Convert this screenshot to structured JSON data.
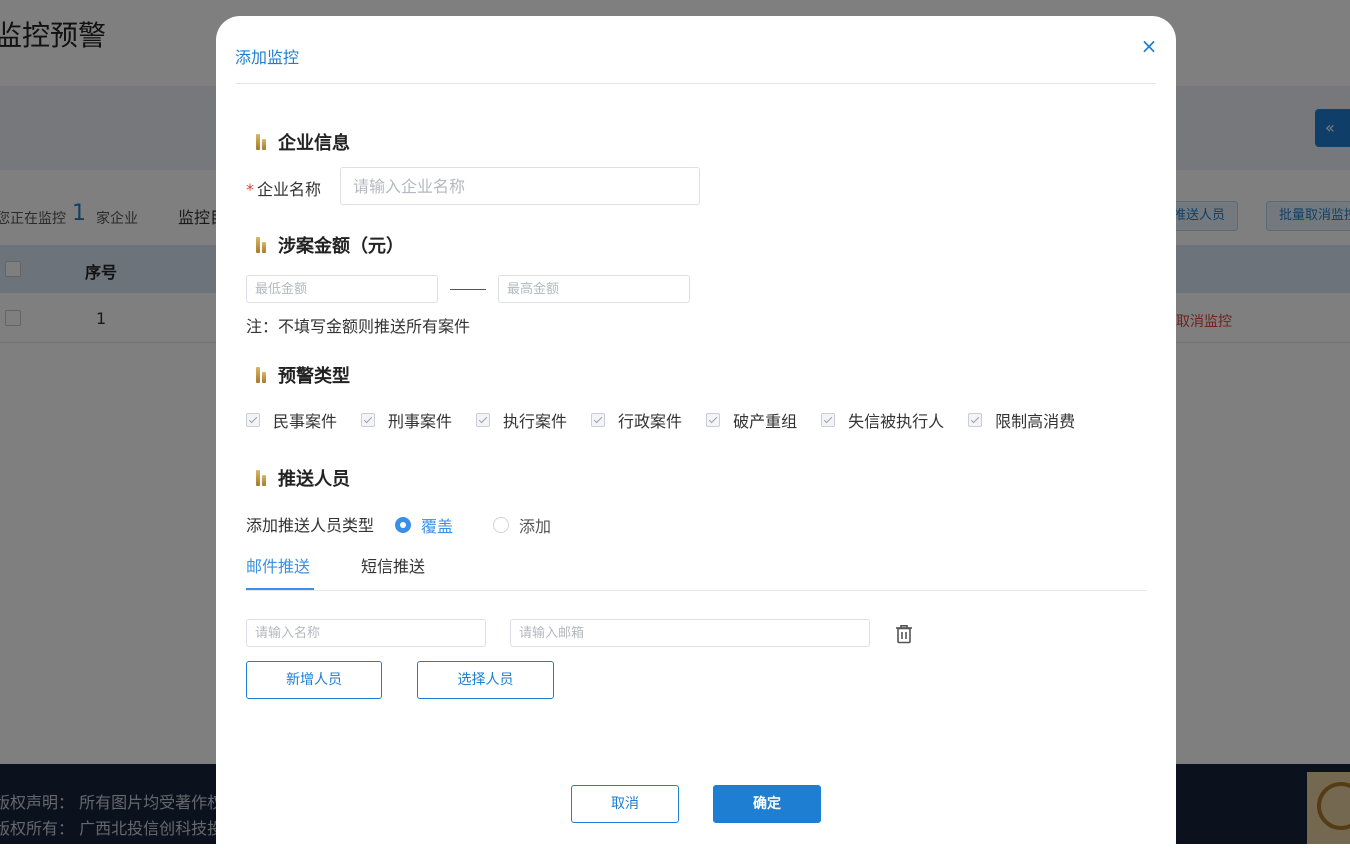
{
  "background": {
    "page_title": "监控预警",
    "collapse_icon": "«",
    "stat_prefix": "您正在监控",
    "stat_count": "1",
    "stat_suffix": "家企业",
    "stat_label": "监控目",
    "btn_push": "推送人员",
    "btn_batch_cancel": "批量取消监控",
    "table_header_index": "序号",
    "row_index": "1",
    "row_action": "取消监控",
    "footer_line1": "版权声明：  所有图片均受著作权保护",
    "footer_line2": "版权所有：  广西北投信创科技投资"
  },
  "dialog": {
    "title": "添加监控",
    "close_icon": "×",
    "sections": {
      "company": "企业信息",
      "amount": "涉案金额（元）",
      "alert_type": "预警类型",
      "push": "推送人员"
    },
    "company_name_label": "企业名称",
    "company_name_required": "*",
    "company_name_placeholder": "请输入企业名称",
    "company_name_value": "",
    "min_amount_placeholder": "最低金额",
    "max_amount_placeholder": "最高金额",
    "amount_note": "注：不填写金额则推送所有案件",
    "alert_types": [
      "民事案件",
      "刑事案件",
      "执行案件",
      "行政案件",
      "破产重组",
      "失信被执行人",
      "限制高消费"
    ],
    "push_type_label": "添加推送人员类型",
    "push_type_options": {
      "cover": "覆盖",
      "add": "添加"
    },
    "push_type_selected": "覆盖",
    "tabs": {
      "email": "邮件推送",
      "sms": "短信推送"
    },
    "active_tab": "邮件推送",
    "name_placeholder": "请输入名称",
    "email_placeholder": "请输入邮箱",
    "add_person": "新增人员",
    "select_person": "选择人员",
    "cancel": "取消",
    "confirm": "确定"
  },
  "colors": {
    "accent": "#1e7ed1",
    "tab_active": "#3b8fe6",
    "required": "#e0453a",
    "section_icon": "#c19a4a",
    "overlay": "rgba(0,0,0,0.5)",
    "footer": "#17243a"
  }
}
